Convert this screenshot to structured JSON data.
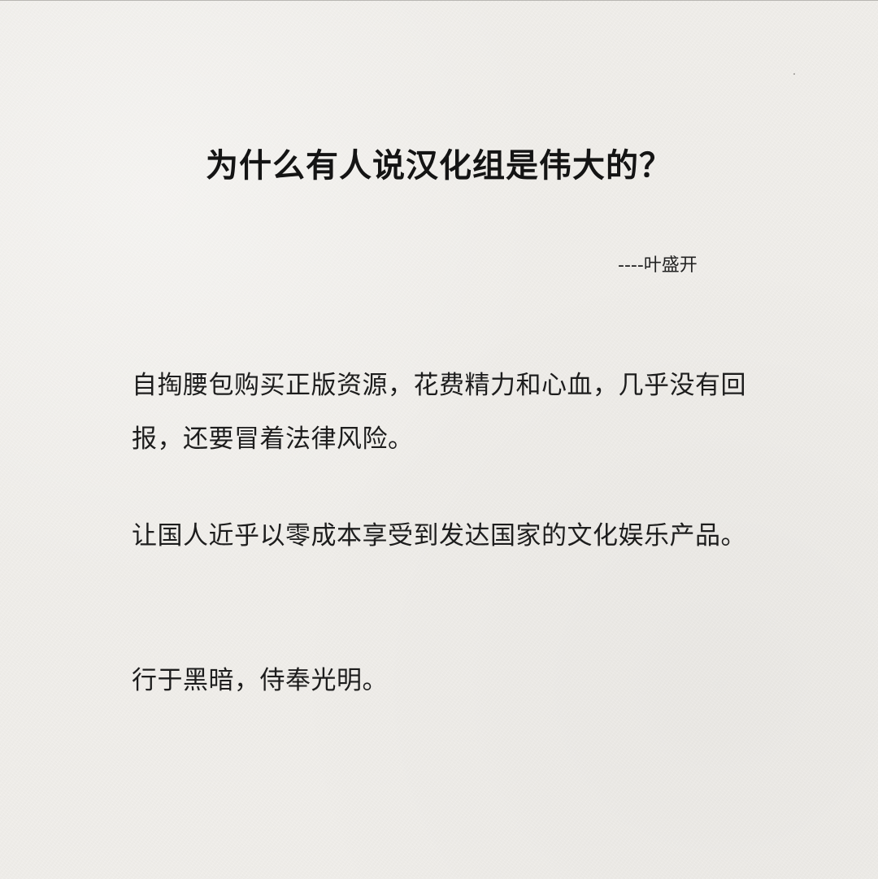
{
  "article": {
    "title": "为什么有人说汉化组是伟大的？",
    "author": "----叶盛开",
    "paragraphs": [
      "自掏腰包购买正版资源，花费精力和心血，几乎没有回报，还要冒着法律风险。",
      "让国人近乎以零成本享受到发达国家的文化娱乐产品。",
      "行于黑暗，侍奉光明。"
    ]
  },
  "colors": {
    "background": "#eeece8",
    "text": "#1d1d1d",
    "title": "#141414"
  }
}
